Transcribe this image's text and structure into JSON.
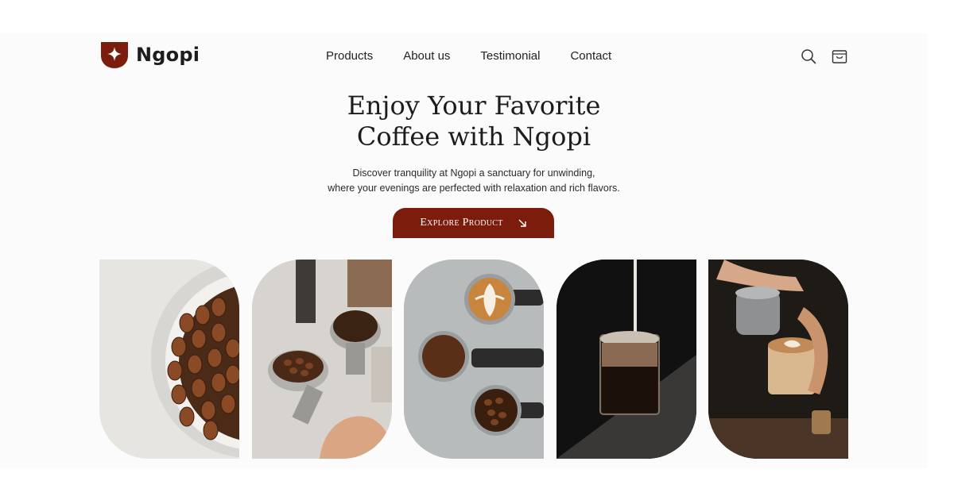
{
  "brand": {
    "name": "Ngopi",
    "accent_color": "#7b1c0d",
    "logo_icon": "shield-star-icon"
  },
  "nav": {
    "items": [
      {
        "label": "Products"
      },
      {
        "label": "About us"
      },
      {
        "label": "Testimonial"
      },
      {
        "label": "Contact"
      }
    ]
  },
  "header_icons": [
    "search-icon",
    "cart-icon"
  ],
  "hero": {
    "title_line1": "Enjoy Your Favorite",
    "title_line2": "Coffee with Ngopi",
    "subtitle_line1": "Discover tranquility at Ngopi a sanctuary for unwinding,",
    "subtitle_line2": "where your evenings are perfected with relaxation and rich flavors.",
    "cta_label": "Explore Product",
    "cta_icon": "arrow-down-right-icon"
  },
  "gallery": [
    {
      "name": "coffee-beans-bowl-image"
    },
    {
      "name": "portafilters-grounds-image"
    },
    {
      "name": "latte-portafilters-image"
    },
    {
      "name": "iced-coffee-milk-pour-image"
    },
    {
      "name": "latte-art-pour-image"
    }
  ]
}
